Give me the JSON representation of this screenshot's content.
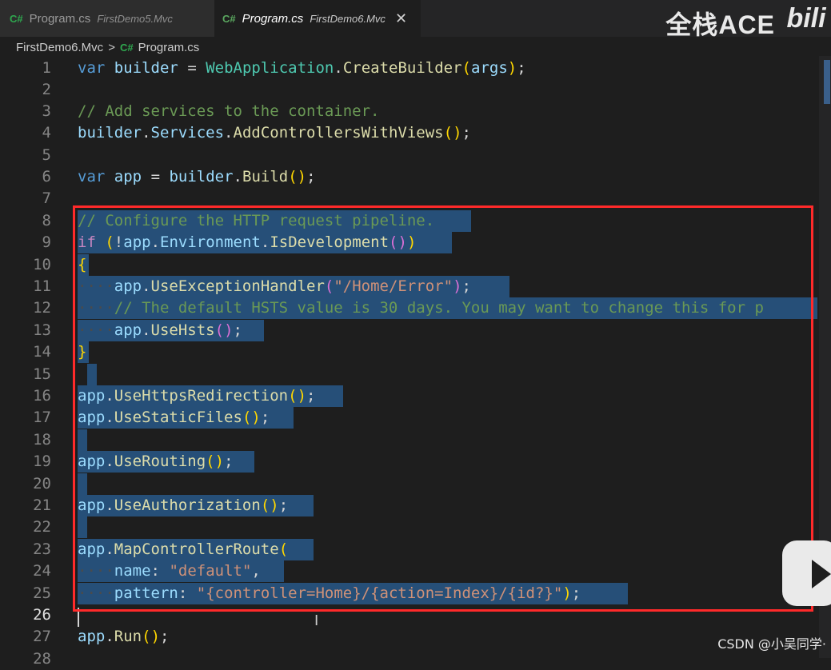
{
  "tabs": [
    {
      "lang_icon": "C#",
      "file": "Program.cs",
      "path": "FirstDemo5.Mvc"
    },
    {
      "lang_icon": "C#",
      "file": "Program.cs",
      "path": "FirstDemo6.Mvc",
      "close": "✕"
    }
  ],
  "watermark": {
    "text": "全栈ACE",
    "logo": "bili"
  },
  "breadcrumb": {
    "project": "FirstDemo6.Mvc",
    "separator": ">",
    "lang_icon": "C#",
    "file": "Program.cs"
  },
  "editor": {
    "current_line": 26,
    "line_numbers": [
      "1",
      "2",
      "3",
      "4",
      "5",
      "6",
      "7",
      "8",
      "9",
      "10",
      "11",
      "12",
      "13",
      "14",
      "15",
      "16",
      "17",
      "18",
      "19",
      "20",
      "21",
      "22",
      "23",
      "24",
      "25",
      "26",
      "27",
      "28"
    ],
    "lines": {
      "l1": {
        "var": "var",
        "builder": "builder",
        "eq": "=",
        "cls": "WebApplication",
        "dot": ".",
        "fn": "CreateBuilder",
        "po": "(",
        "args": "args",
        "pc": ")",
        "semi": ";"
      },
      "l3": "// Add services to the container.",
      "l4": {
        "builder": "builder",
        "dot1": ".",
        "services": "Services",
        "dot2": ".",
        "fn": "AddControllersWithViews",
        "po": "(",
        "pc": ")",
        "semi": ";"
      },
      "l6": {
        "var": "var",
        "app": "app",
        "eq": "=",
        "builder": "builder",
        "dot": ".",
        "fn": "Build",
        "po": "(",
        "pc": ")",
        "semi": ";"
      },
      "l8": {
        "slashes": "//",
        "text": " Configure the HTTP request pipeline."
      },
      "l9": {
        "kw": "if",
        "po": "(",
        "not": "!",
        "app": "app",
        "dot1": ".",
        "env": "Environment",
        "dot2": ".",
        "fn": "IsDevelopment",
        "ipo": "(",
        "ipc": ")",
        "pc": ")"
      },
      "l10": "{",
      "l11": {
        "indent": "····",
        "app": "app",
        "dot": ".",
        "fn": "UseExceptionHandler",
        "po": "(",
        "str": "\"/Home/Error\"",
        "pc": ")",
        "semi": ";"
      },
      "l12": {
        "indent": "····",
        "text": "// The default HSTS value is 30 days. You may want to change this for p"
      },
      "l13": {
        "indent": "····",
        "app": "app",
        "dot": ".",
        "fn": "UseHsts",
        "po": "(",
        "pc": ")",
        "semi": ";"
      },
      "l14": "}",
      "l16": {
        "app": "app",
        "dot": ".",
        "fn": "UseHttpsRedirection",
        "po": "(",
        "pc": ")",
        "semi": ";"
      },
      "l17": {
        "app": "app",
        "dot": ".",
        "fn": "UseStaticFiles",
        "po": "(",
        "pc": ")",
        "semi": ";"
      },
      "l19": {
        "app": "app",
        "dot": ".",
        "fn": "UseRouting",
        "po": "(",
        "pc": ")",
        "semi": ";"
      },
      "l21": {
        "app": "app",
        "dot": ".",
        "fn": "UseAuthorization",
        "po": "(",
        "pc": ")",
        "semi": ";"
      },
      "l23": {
        "app": "app",
        "dot": ".",
        "fn": "MapControllerRoute",
        "po": "("
      },
      "l24": {
        "indent": "····",
        "name": "name",
        "colon": ":",
        "str": "\"default\"",
        "comma": ","
      },
      "l25": {
        "indent": "····",
        "pattern": "pattern",
        "colon": ":",
        "str": "\"{controller=Home}/{action=Index}/{id?}\"",
        "pc": ")",
        "semi": ";"
      },
      "l27": {
        "app": "app",
        "dot": ".",
        "fn": "Run",
        "po": "(",
        "pc": ")",
        "semi": ";"
      }
    }
  },
  "credit": "CSDN @小吴同学·",
  "colors": {
    "selection": "#264f78",
    "annotation_box": "#ff2a2a",
    "background": "#1e1e1e"
  },
  "icons": {
    "play": "play-icon",
    "close": "close-icon",
    "csharp": "csharp-file-icon"
  }
}
